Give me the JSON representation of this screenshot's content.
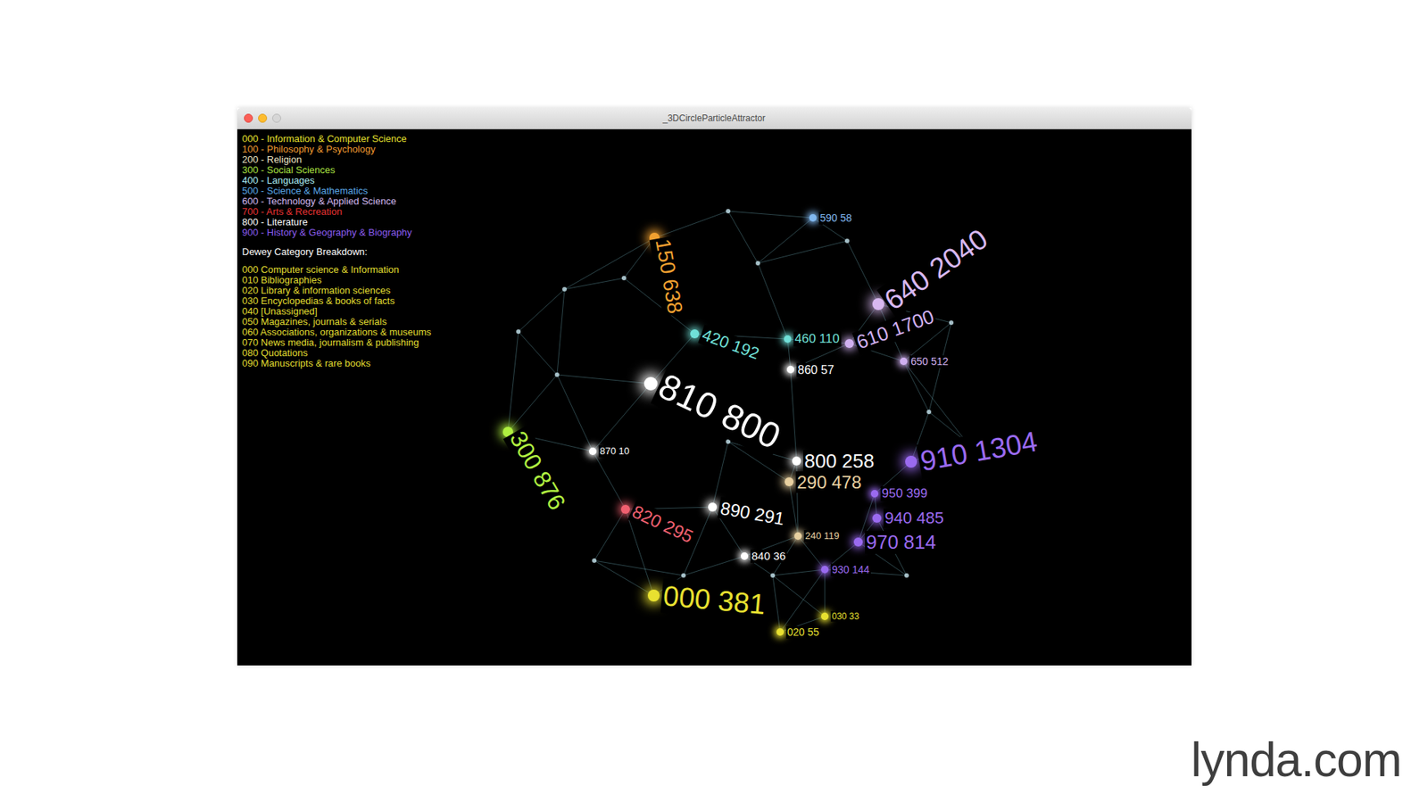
{
  "window": {
    "title": "_3DCircleParticleAttractor"
  },
  "legend": {
    "classes": [
      {
        "label": "000 - Information & Computer Science",
        "color": "#e6e02e"
      },
      {
        "label": "100 - Philosophy & Psychology",
        "color": "#f09a30"
      },
      {
        "label": "200 - Religion",
        "color": "#efe6c4"
      },
      {
        "label": "300 - Social Sciences",
        "color": "#a8e040"
      },
      {
        "label": "400 - Languages",
        "color": "#a8ecf4"
      },
      {
        "label": "500 - Science & Mathematics",
        "color": "#5aa8e8"
      },
      {
        "label": "600 - Technology & Applied Science",
        "color": "#d0b8f0"
      },
      {
        "label": "700 - Arts & Recreation",
        "color": "#e83232"
      },
      {
        "label": "800 - Literature",
        "color": "#ffffff"
      },
      {
        "label": "900 - History & Geography & Biography",
        "color": "#8a5cf0"
      }
    ],
    "heading": "Dewey Category Breakdown:",
    "breakdown": [
      "000 Computer science & Information",
      "010 Bibliographies",
      "020 Library & information sciences",
      "030 Encyclopedias & books of facts",
      "040 [Unassigned]",
      "050 Magazines, journals & serials",
      "060 Associations, organizations & museums",
      "070 News media, journalism & publishing",
      "080 Quotations",
      "090 Manuscripts & rare books"
    ]
  },
  "nodes": [
    {
      "label": "810 800",
      "color": "#ffffff"
    },
    {
      "label": "800 258",
      "color": "#ffffff"
    },
    {
      "label": "290 478",
      "color": "#e8d0a0"
    },
    {
      "label": "890 291",
      "color": "#ffffff"
    },
    {
      "label": "820 295",
      "color": "#f06070"
    },
    {
      "label": "840 36",
      "color": "#ffffff"
    },
    {
      "label": "240 119",
      "color": "#e8d0a0"
    },
    {
      "label": "000 381",
      "color": "#e8e030"
    },
    {
      "label": "020 55",
      "color": "#e8e030"
    },
    {
      "label": "030 33",
      "color": "#e8e030"
    },
    {
      "label": "970 814",
      "color": "#9a6af0"
    },
    {
      "label": "940 485",
      "color": "#9a6af0"
    },
    {
      "label": "950 399",
      "color": "#9a6af0"
    },
    {
      "label": "930 144",
      "color": "#9a6af0"
    },
    {
      "label": "910 1304",
      "color": "#9a6af0"
    },
    {
      "label": "640 2040",
      "color": "#d8b8f0"
    },
    {
      "label": "610 1700",
      "color": "#d0b0f0"
    },
    {
      "label": "650 512",
      "color": "#d0b0f0"
    },
    {
      "label": "860 57",
      "color": "#ffffff"
    },
    {
      "label": "460 110",
      "color": "#70e0d8"
    },
    {
      "label": "420 192",
      "color": "#70e0d8"
    },
    {
      "label": "150 638",
      "color": "#f0a030"
    },
    {
      "label": "300 876",
      "color": "#b0f040"
    },
    {
      "label": "590 58",
      "color": "#80b8f0"
    },
    {
      "label": "870 10",
      "color": "#ffffff"
    }
  ],
  "watermark": "lynda.com"
}
